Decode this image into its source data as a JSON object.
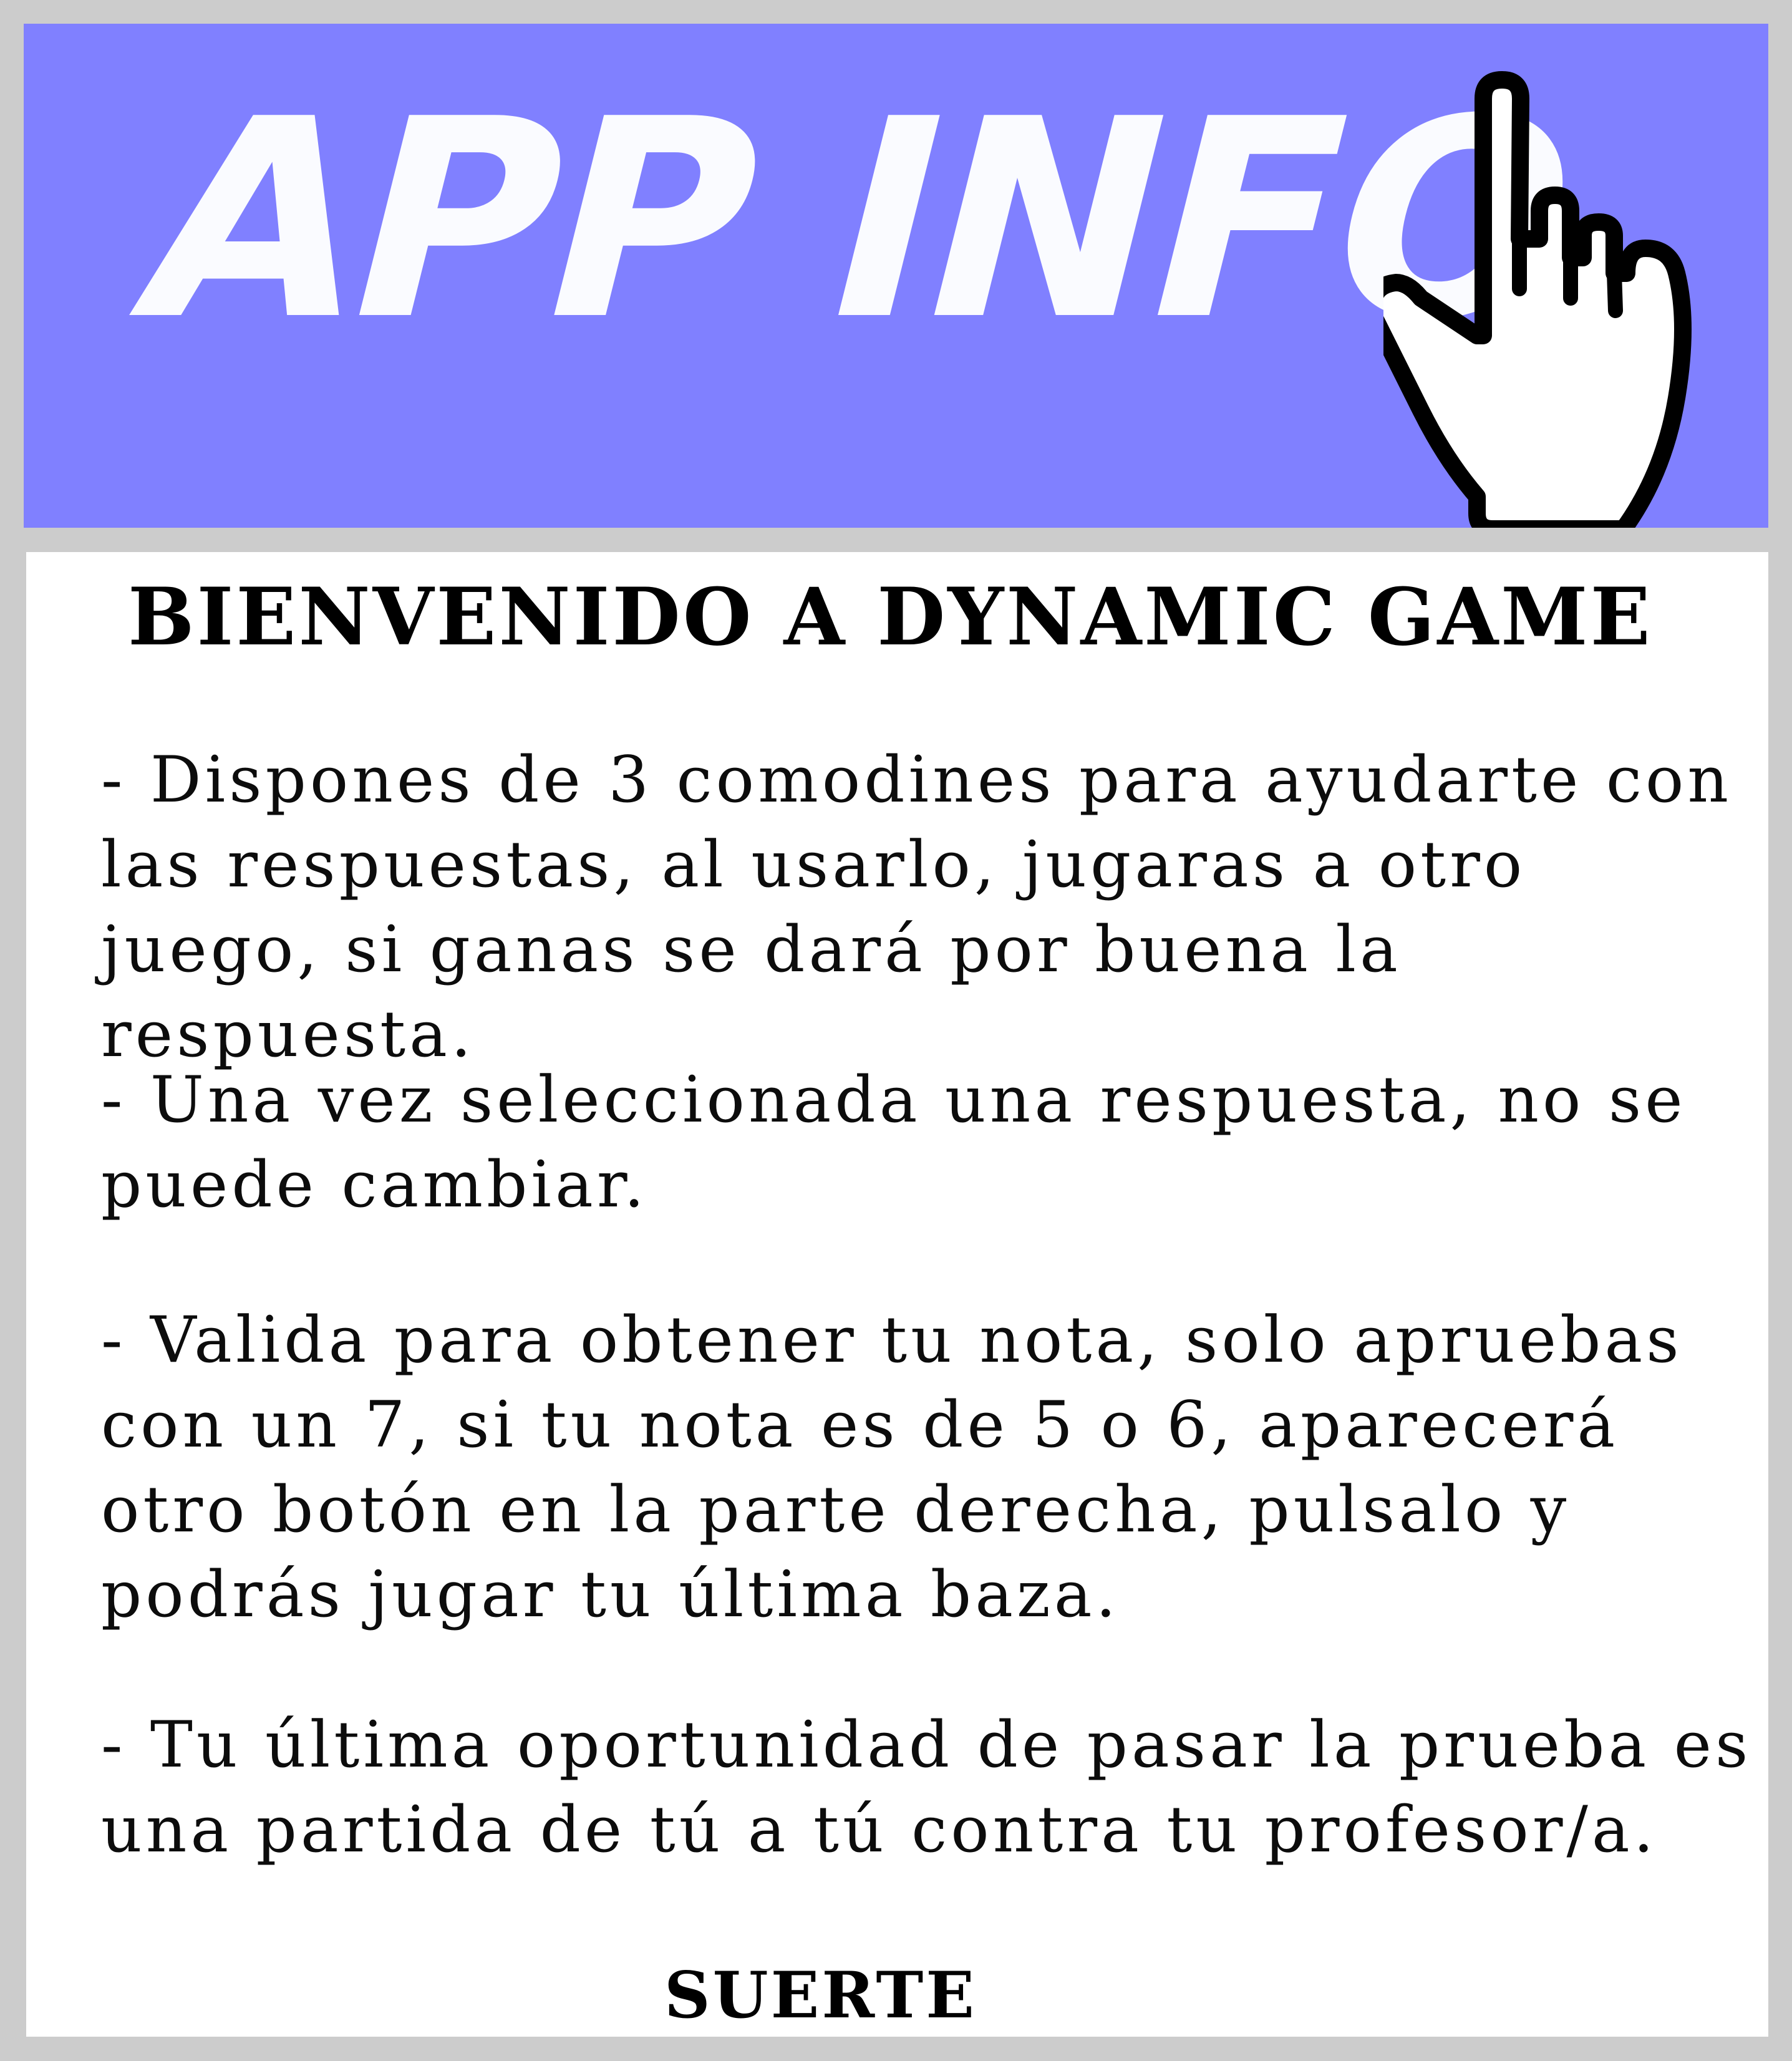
{
  "header": {
    "title": "APP INFO",
    "icon": "pointing-hand-icon",
    "background_color": "#8080ff",
    "title_color": "#fafbff"
  },
  "content": {
    "heading": "BIENVENIDO A DYNAMIC GAME",
    "rules": [
      "- Dispones de 3 comodines para ayudarte con las respuestas, al usarlo, jugaras a otro juego, si ganas se dará por buena la respuesta.",
      "- Una vez seleccionada una respuesta, no se puede cambiar.",
      "- Valida para obtener tu nota, solo apruebas con un 7, si tu nota es de 5 o 6, aparecerá otro botón en la parte derecha, pulsalo y podrás jugar tu última baza.",
      "- Tu última oportunidad de pasar la prueba es una partida de tú a tú contra tu profesor/a."
    ],
    "farewell": "SUERTE"
  }
}
